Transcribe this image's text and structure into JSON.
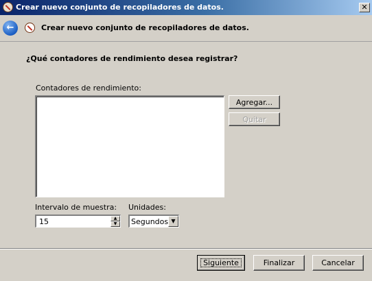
{
  "window": {
    "title": "Crear nuevo conjunto de recopiladores de datos.",
    "close_glyph": "✕"
  },
  "nav": {
    "back_glyph": "←",
    "wizard_title": "Crear nuevo conjunto de recopiladores de datos."
  },
  "main": {
    "question": "¿Qué contadores de rendimiento desea registrar?",
    "counters_label": "Contadores de rendimiento:",
    "add_button": "Agregar...",
    "remove_button": "Quitar",
    "interval_label": "Intervalo de muestra:",
    "interval_value": "15",
    "units_label": "Unidades:",
    "units_value": "Segundos"
  },
  "footer": {
    "next_button": "Siguiente",
    "finish_button": "Finalizar",
    "cancel_button": "Cancelar"
  },
  "icons": {
    "app": "perfmon-icon",
    "back": "back-arrow-icon",
    "wizard": "perfmon-icon",
    "close": "close-icon"
  }
}
